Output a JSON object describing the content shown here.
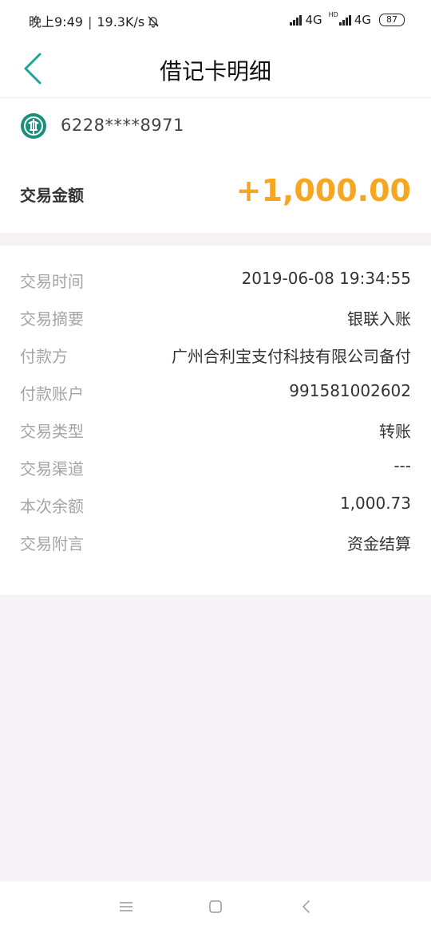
{
  "status_bar": {
    "time": "晚上9:49",
    "separator": "|",
    "speed": "19.3K/s",
    "network_1": "4G",
    "hd_tag": "HD",
    "network_2": "4G",
    "battery": "87"
  },
  "header": {
    "title": "借记卡明细"
  },
  "card": {
    "number": "6228****8971"
  },
  "amount": {
    "label": "交易金额",
    "value": "+1,000.00"
  },
  "details": [
    {
      "label": "交易时间",
      "value": "2019-06-08 19:34:55"
    },
    {
      "label": "交易摘要",
      "value": "银联入账"
    },
    {
      "label": "付款方",
      "value": "广州合利宝支付科技有限公司备付"
    },
    {
      "label": "付款账户",
      "value": "991581002602"
    },
    {
      "label": "交易类型",
      "value": "转账"
    },
    {
      "label": "交易渠道",
      "value": "---"
    },
    {
      "label": "本次余额",
      "value": "1,000.73"
    },
    {
      "label": "交易附言",
      "value": "资金结算"
    }
  ],
  "colors": {
    "accent": "#1aa89a",
    "amount": "#f5a623",
    "bank_logo": "#1a8f7a"
  }
}
